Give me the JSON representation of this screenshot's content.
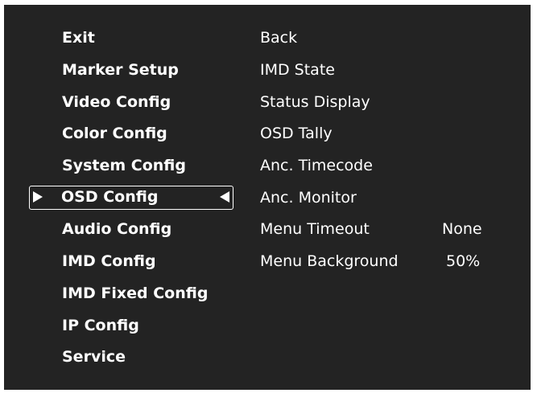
{
  "main_menu": {
    "items": [
      {
        "label": "Exit"
      },
      {
        "label": "Marker Setup"
      },
      {
        "label": "Video Config"
      },
      {
        "label": "Color Config"
      },
      {
        "label": "System Config"
      },
      {
        "label": "OSD Config",
        "selected": true
      },
      {
        "label": "Audio Config"
      },
      {
        "label": "IMD Config"
      },
      {
        "label": "IMD Fixed Config"
      },
      {
        "label": "IP Config"
      },
      {
        "label": "Service"
      }
    ]
  },
  "sub_menu": {
    "items": [
      {
        "label": "Back"
      },
      {
        "label": "IMD State"
      },
      {
        "label": "Status Display"
      },
      {
        "label": "OSD Tally"
      },
      {
        "label": "Anc. Timecode"
      },
      {
        "label": "Anc. Monitor"
      },
      {
        "label": "Menu Timeout",
        "value": "None"
      },
      {
        "label": "Menu Background",
        "value": "50%"
      }
    ]
  },
  "colors": {
    "background": "#232323",
    "text": "#ffffff",
    "page": "#ffffff"
  }
}
